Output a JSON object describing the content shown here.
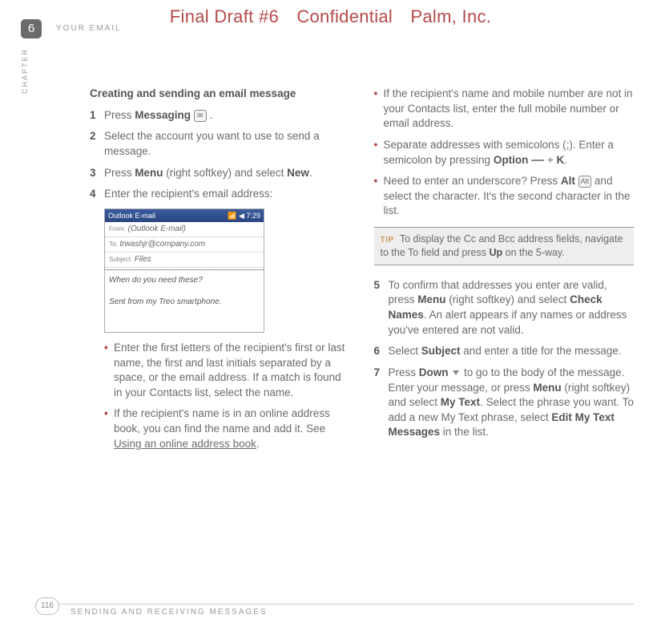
{
  "watermark": "Final Draft #6 Confidential Palm, Inc.",
  "chapter_number": "6",
  "section_header": "YOUR EMAIL",
  "chapter_label": "CHAPTER",
  "page_number": "116",
  "footer_title": "SENDING AND RECEIVING MESSAGES",
  "left": {
    "heading": "Creating and sending an email message",
    "steps": {
      "s1": {
        "num": "1",
        "pre": "Press ",
        "b1": "Messaging",
        "post": " ."
      },
      "s2": {
        "num": "2",
        "text": "Select the account you want to use to send a message."
      },
      "s3": {
        "num": "3",
        "pre": "Press ",
        "b1": "Menu",
        "mid": " (right softkey) and select ",
        "b2": "New",
        "post": "."
      },
      "s4": {
        "num": "4",
        "text": "Enter the recipient's email address:"
      }
    },
    "screenshot": {
      "titlebar_left": "Outlook E-mail",
      "titlebar_right": "📶 ◀ 7:29",
      "from_label": "From:",
      "from_value": "(Outlook E-mail)",
      "to_label": "To:",
      "to_value": "trwashjr@company.com",
      "subject_label": "Subject:",
      "subject_value": "Files",
      "body_line1": "When do you need these?",
      "body_line2": "Sent from my Treo smartphone."
    },
    "bullets": {
      "b1": "Enter the first letters of the recipient's first or last name, the first and last initials separated by a space, or the email address. If a match is found in your Contacts list, select the name.",
      "b2_pre": "If the recipient's name is in an online address book, you can find the name and add it. See ",
      "b2_link": "Using an online address book",
      "b2_post": "."
    }
  },
  "right": {
    "bullets": {
      "b1": "If the recipient's name and mobile number are not in your Contacts list, enter the full mobile number or email address.",
      "b2_pre": "Separate addresses with semicolons (;). Enter a semicolon by pressing ",
      "b2_bold1": "Option",
      "b2_mid": "  + ",
      "b2_bold2": "K",
      "b2_post": ".",
      "b3_pre": "Need to enter an underscore? Press ",
      "b3_bold1": "Alt",
      "b3_post": " and select the character. It's the second character in the list."
    },
    "tip_label": "TIP",
    "tip_pre": "To display the Cc and Bcc address fields, navigate to the To field and press ",
    "tip_bold": "Up",
    "tip_post": " on the 5-way.",
    "steps": {
      "s5": {
        "num": "5",
        "pre": "To confirm that addresses you enter are valid, press ",
        "b1": "Menu",
        "mid1": " (right softkey) and select ",
        "b2": "Check Names",
        "post": ". An alert appears if any names or address you've entered are not valid."
      },
      "s6": {
        "num": "6",
        "pre": "Select ",
        "b1": "Subject",
        "post": " and enter a title for the message."
      },
      "s7": {
        "num": "7",
        "pre": "Press ",
        "b1": "Down",
        "mid1": " to go to the body of the message. Enter your message, or press ",
        "b2": "Menu",
        "mid2": " (right softkey) and select ",
        "b3": "My Text",
        "mid3": ". Select the phrase you want. To add a new My Text phrase, select ",
        "b4": "Edit My Text Messages",
        "post": " in the list."
      }
    }
  },
  "icons": {
    "messaging": "✉",
    "option": " ",
    "alt": "Alt"
  }
}
